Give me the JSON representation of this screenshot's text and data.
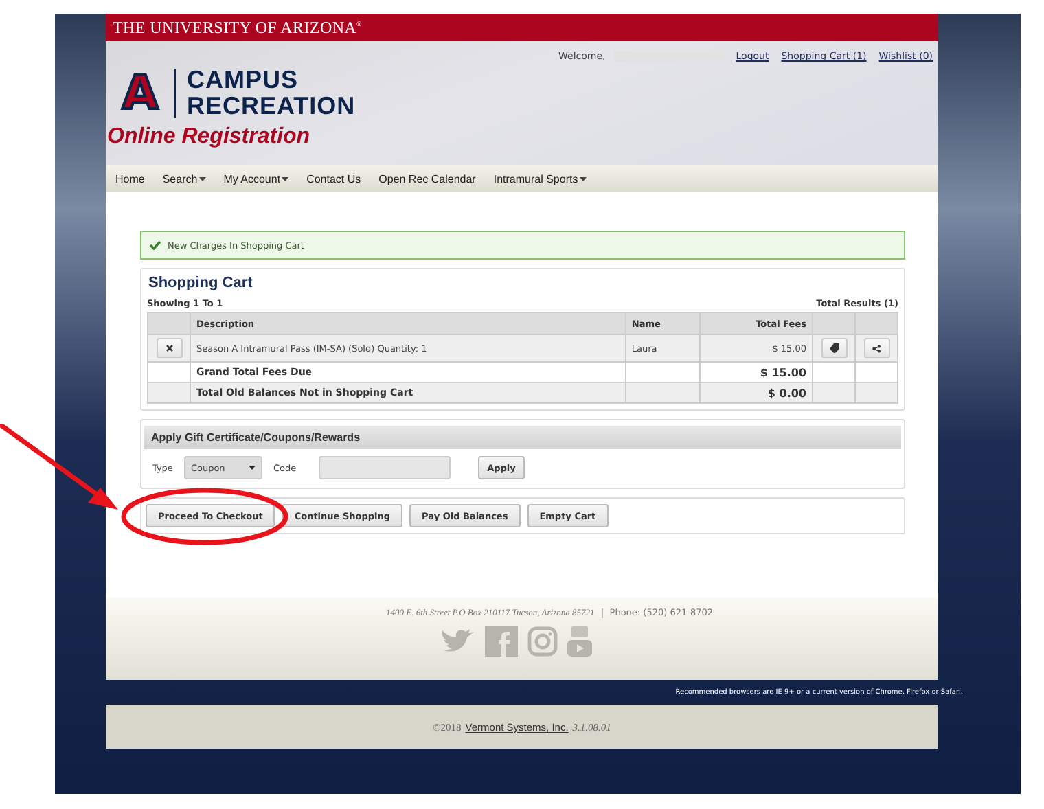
{
  "header": {
    "brand": "THE UNIVERSITY OF ARIZONA",
    "brand_mark": "®"
  },
  "user_bar": {
    "welcome": "Welcome,",
    "links": [
      "Logout",
      "Shopping Cart (1)",
      "Wishlist (0)"
    ]
  },
  "logo": {
    "emblem": "A",
    "line1": "CAMPUS",
    "line2": "RECREATION"
  },
  "app_title": "Online Registration",
  "nav": [
    {
      "label": "Home",
      "dropdown": false
    },
    {
      "label": "Search",
      "dropdown": true
    },
    {
      "label": "My Account",
      "dropdown": true
    },
    {
      "label": "Contact Us",
      "dropdown": false
    },
    {
      "label": "Open Rec Calendar",
      "dropdown": false
    },
    {
      "label": "Intramural Sports",
      "dropdown": true
    }
  ],
  "alert": {
    "message": "New Charges In Shopping Cart"
  },
  "cart": {
    "title": "Shopping Cart",
    "showing": "Showing 1 To 1",
    "total_results": "Total Results (1)",
    "columns": [
      "Description",
      "Name",
      "Total Fees"
    ],
    "rows": [
      {
        "description": "Season A Intramural Pass (IM-SA) (Sold) Quantity: 1",
        "name": "Laura",
        "fees": "$ 15.00"
      }
    ],
    "summary": [
      {
        "label": "Grand Total Fees Due",
        "amount": "$ 15.00"
      },
      {
        "label": "Total Old Balances Not in Shopping Cart",
        "amount": "$ 0.00"
      }
    ]
  },
  "gift": {
    "title": "Apply Gift Certificate/Coupons/Rewards",
    "type_label": "Type",
    "type_value": "Coupon",
    "code_label": "Code",
    "apply": "Apply"
  },
  "actions": [
    "Proceed To Checkout",
    "Continue Shopping",
    "Pay Old Balances",
    "Empty Cart"
  ],
  "footer": {
    "address": "1400 E. 6th Street P.O Box 210117 Tucson, Arizona 85721",
    "phone": "Phone: (520) 621-8702"
  },
  "browser_note": "Recommended browsers are IE 9+ or a current version of Chrome, Firefox or Safari.",
  "copyright": {
    "prefix": "©2018",
    "link": "Vermont Systems, Inc.",
    "version": "3.1.08.01"
  }
}
